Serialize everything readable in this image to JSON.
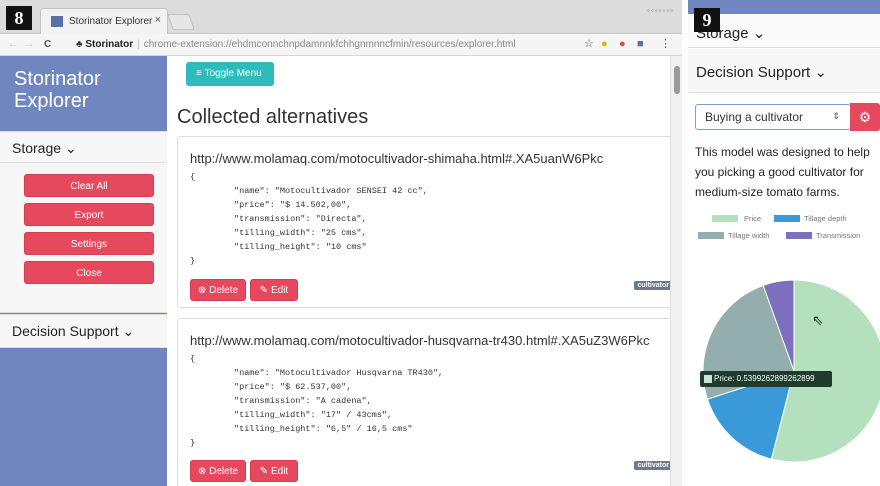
{
  "figure_labels": {
    "left": "8",
    "right": "9"
  },
  "browser": {
    "tab_title": "Storinator Explorer",
    "tab_close": "×",
    "window_controls": "◦◦◦◦◦◦◦",
    "back": "←",
    "forward": "→",
    "reload": "C",
    "site_label": "Storinator",
    "url_path": "chrome-extension://ehdmconnchnpdamnnkfchhgnmnncfmin/resources/explorer.html",
    "star": "☆",
    "menu": "⋮"
  },
  "sidebar": {
    "title": "Storinator Explorer",
    "storage_label": "Storage",
    "buttons": {
      "clear_all": "Clear All",
      "export": "Export",
      "settings": "Settings",
      "close": "Close"
    },
    "decision_support_label": "Decision Support"
  },
  "main": {
    "toggle_label": "Toggle Menu",
    "heading": "Collected alternatives",
    "cards": [
      {
        "url": "http://www.molamaq.com/motocultivador-shimaha.html#.XA5uanW6Pkc",
        "json": [
          "{",
          "\"name\": \"Motocultivador SENSEI 42 cc\",",
          "\"price\": \"$ 14.502,00\",",
          "\"transmission\": \"Directa\",",
          "\"tilling_width\": \"25 cms\",",
          "\"tilling_height\": \"10 cms\"",
          "}"
        ],
        "tag": "cultivator",
        "delete": "Delete",
        "edit": "Edit"
      },
      {
        "url": "http://www.molamaq.com/motocultivador-husqvarna-tr430.html#.XA5uZ3W6Pkc",
        "json": [
          "{",
          "\"name\": \"Motocultivador Husqvarna TR430\",",
          "\"price\": \"$ 62.537,00\",",
          "\"transmission\": \"A cadena\",",
          "\"tilling_width\": \"17\" / 43cms\",",
          "\"tilling_height\": \"6,5\" / 16,5 cms\"",
          "}"
        ],
        "tag": "cultivator",
        "delete": "Delete",
        "edit": "Edit"
      }
    ]
  },
  "right": {
    "storage_label": "Storage",
    "decision_support_label": "Decision Support",
    "select_value": "Buying a cultivator",
    "description": "This model was designed to help you picking a good cultivator for medium-size tomato farms.",
    "tooltip": "Price: 0.5399262899262899"
  },
  "chart_data": {
    "type": "pie",
    "title": "",
    "series": [
      {
        "name": "Price",
        "value": 0.5399262899262899,
        "color": "#b4e0be"
      },
      {
        "name": "Tillage depth",
        "value": 0.16,
        "color": "#3a9ad9"
      },
      {
        "name": "Tillage width",
        "value": 0.245,
        "color": "#93aeac"
      },
      {
        "name": "Transmission",
        "value": 0.055,
        "color": "#7e6fbe"
      }
    ],
    "legend_position": "top"
  }
}
